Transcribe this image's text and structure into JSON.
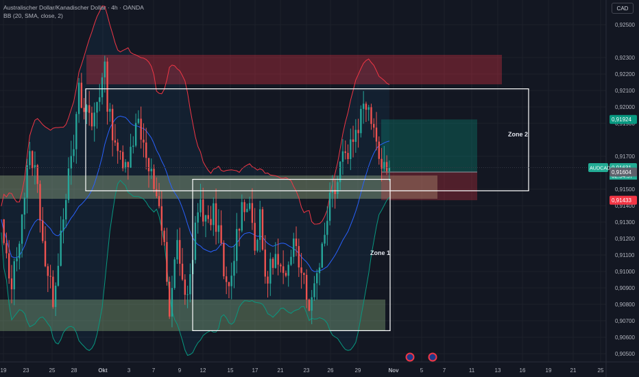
{
  "header": {
    "title": "Australischer Dollar/Kanadischer Dollar · 4h · OANDA",
    "indicator": "BB (20, SMA, close, 2)"
  },
  "currency_button": "CAD",
  "zones": {
    "zone1": "Zone 1",
    "zone2": "Zone 2"
  },
  "price_tags": {
    "target": "0,91924",
    "symbol": "AUDCAD",
    "last": "0,91631",
    "countdown": "02:54:57",
    "entry": "0,91604",
    "stop": "0,91433"
  },
  "colors": {
    "background": "#131722",
    "up": "#26a69a",
    "down": "#ef5350",
    "bb_upper": "#f23645",
    "bb_basis": "#2962ff",
    "bb_lower": "#089981",
    "target_tag": "#089981",
    "stop_tag": "#f23645"
  },
  "chart_data": {
    "type": "candlestick",
    "symbol": "AUDCAD",
    "timeframe": "4h",
    "y_axis": {
      "range": [
        0.9045,
        0.9265
      ],
      "tick_labels": [
        "0,92500",
        "0,92300",
        "0,92200",
        "0,92100",
        "0,92000",
        "0,91900",
        "0,91700",
        "0,91500",
        "0,91400",
        "0,91300",
        "0,91200",
        "0,91100",
        "0,91000",
        "0,90900",
        "0,90800",
        "0,90700",
        "0,90600",
        "0,90500"
      ],
      "tick_values": [
        0.925,
        0.923,
        0.922,
        0.921,
        0.92,
        0.919,
        0.917,
        0.915,
        0.914,
        0.913,
        0.912,
        0.911,
        0.91,
        0.909,
        0.908,
        0.907,
        0.906,
        0.905
      ]
    },
    "x_axis": {
      "labels": [
        "19",
        "23",
        "25",
        "28",
        "Okt",
        "3",
        "7",
        "9",
        "12",
        "15",
        "17",
        "21",
        "23",
        "26",
        "29",
        "Nov",
        "5",
        "7",
        "11",
        "13",
        "16",
        "19",
        "21",
        "25"
      ]
    },
    "zones": [
      {
        "label": "Zone 1",
        "price_top": 0.9156,
        "price_bottom": 0.9064
      },
      {
        "label": "Zone 2",
        "price_top": 0.9211,
        "price_bottom": 0.9149
      }
    ],
    "position": {
      "target": 0.91924,
      "entry": 0.91604,
      "stop": 0.91433,
      "last": 0.91631
    },
    "price_path": [
      [
        0.9128,
        0.9108,
        0.9092,
        0.91,
        0.912,
        0.914,
        0.916,
        0.9172,
        0.9158,
        0.9138
      ],
      [
        0.911,
        0.9092,
        0.9085,
        0.9105,
        0.913,
        0.915,
        0.916,
        0.918,
        0.9208,
        0.9196
      ],
      [
        0.92,
        0.9188,
        0.9205,
        0.9212,
        0.922,
        0.9195,
        0.9185,
        0.9175,
        0.916,
        0.9165
      ],
      [
        0.918,
        0.9185,
        0.9192,
        0.9178,
        0.917,
        0.9155,
        0.9145,
        0.9125,
        0.911,
        0.9075
      ],
      [
        0.9105,
        0.9115,
        0.909,
        0.9078,
        0.91,
        0.913,
        0.914,
        0.9135,
        0.9125,
        0.914
      ],
      [
        0.913,
        0.911,
        0.909,
        0.9085,
        0.911,
        0.913,
        0.914,
        0.9145,
        0.9135,
        0.9115
      ],
      [
        0.913,
        0.91,
        0.9095,
        0.911,
        0.9105,
        0.9098,
        0.9092,
        0.91,
        0.913,
        0.911
      ],
      [
        0.91,
        0.9085,
        0.908,
        0.91,
        0.911,
        0.9125,
        0.9145,
        0.915,
        0.916,
        0.9175
      ],
      [
        0.917,
        0.9178,
        0.9185,
        0.9192,
        0.92,
        0.9205,
        0.9195,
        0.918,
        0.917,
        0.9165
      ],
      [
        0.916
      ]
    ]
  }
}
